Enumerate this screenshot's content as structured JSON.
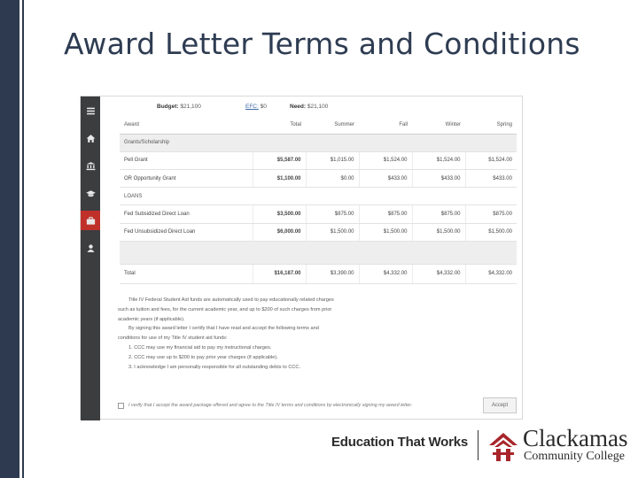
{
  "slide": {
    "title": "Award Letter Terms and Conditions"
  },
  "summary": {
    "budget_label": "Budget:",
    "budget_value": "$21,100",
    "efc_label": "EFC:",
    "efc_value": "$0",
    "need_label": "Need:",
    "need_value": "$21,100"
  },
  "sidebar": {
    "icons": [
      "menu-icon",
      "home-icon",
      "bank-icon",
      "graduation-cap-icon",
      "briefcase-icon",
      "person-icon"
    ],
    "active_index": 4
  },
  "table": {
    "headers": [
      "Award",
      "Total",
      "Summer",
      "Fall",
      "Winter",
      "Spring"
    ],
    "sections": [
      {
        "title": "Grants/Scholarship",
        "rows": [
          [
            "Pell Grant",
            "$5,587.00",
            "$1,015.00",
            "$1,524.00",
            "$1,524.00",
            "$1,524.00"
          ],
          [
            "OR Opportunity Grant",
            "$1,100.00",
            "$0.00",
            "$433.00",
            "$433.00",
            "$433.00"
          ]
        ]
      },
      {
        "title": "LOANS",
        "rows": [
          [
            "Fed Subsidized Direct Loan",
            "$3,500.00",
            "$875.00",
            "$875.00",
            "$875.00",
            "$875.00"
          ],
          [
            "Fed Unsubsidized Direct Loan",
            "$6,000.00",
            "$1,500.00",
            "$1,500.00",
            "$1,500.00",
            "$1,500.00"
          ]
        ]
      }
    ],
    "total": [
      "Total",
      "$16,187.00",
      "$3,390.00",
      "$4,332.00",
      "$4,332.00",
      "$4,332.00"
    ]
  },
  "terms": {
    "para1": "Title IV Federal Student Aid funds are automatically used to pay educationally related charges",
    "para1b": "such as tuition and fees, for the current academic year, and up to $200 of such charges from prior",
    "para1c": "academic years (if applicable).",
    "para2": "By signing this award letter I certify that I have read and accept the following terms and",
    "para2b": "conditions for use of my Title IV student aid funds:",
    "items": [
      "1. CCC may use my financial aid to pay my instructional charges.",
      "2. CCC may use up to $200 to pay prior year charges (if applicable).",
      "3. I acknowledge I am personally responsible for all outstanding debts to CCC."
    ]
  },
  "accept": {
    "checkbox_text": "I verify that I accept the award package offered and agree to the Title IV terms and conditions by electronically signing my award letter.",
    "button_label": "Accept"
  },
  "footer": {
    "tagline": "Education That Works",
    "college_name": "Clackamas",
    "college_sub": "Community College",
    "brand_color": "#a8262b"
  }
}
